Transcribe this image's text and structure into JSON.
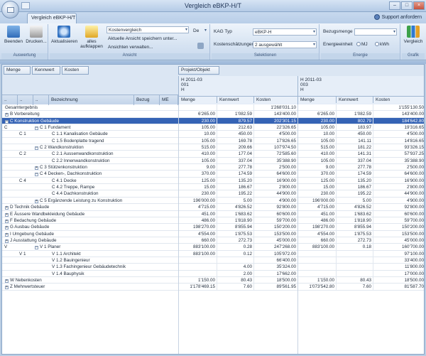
{
  "window": {
    "title": "Vergleich eBKP-H/T",
    "buttons": [
      "–",
      "□",
      "×"
    ]
  },
  "tabs": [
    {
      "label": "Vergleich eBKP-H/T"
    }
  ],
  "support": {
    "label": "Support anfordern"
  },
  "ribbon": {
    "auswertung": {
      "label": "Auswertung",
      "beenden": "Beenden",
      "drucken": "Drucken..."
    },
    "ansicht": {
      "label": "Ansicht",
      "aktualisieren": "Aktualisieren",
      "aufklappen": "alles aufklappen",
      "view_select": "Kostenvergleich",
      "language": "De",
      "save_view": "Aktuelle Ansicht speichern unter...",
      "manage_views": "Ansichten verwalten..."
    },
    "selektionen": {
      "label": "Selektionen",
      "kag_typ_label": "KAG Typ",
      "kag_typ_value": "eBKP-H",
      "kostenschaetzungen_label": "Kostenschätzungen",
      "kostenschaetzungen_value": "2 ausgewählt"
    },
    "energie": {
      "label": "Energie",
      "bezugsmenge_label": "Bezugsmenge",
      "bezugsmenge_value": "",
      "energieeinheit_label": "Energieeinheit",
      "unit_mj": "MJ",
      "unit_kwh": "kWh"
    },
    "grafik": {
      "label": "Grafik",
      "vergleich": "Vergleich"
    }
  },
  "grid": {
    "chips": [
      "Menge",
      "Kennwert",
      "Kosten"
    ],
    "projekt_chip": "Projekt/Objekt",
    "left_headers": [
      "..",
      "..",
      "..",
      "Bezeichnung",
      "Bezug",
      "ME"
    ],
    "projects": [
      {
        "lines": [
          "H 2011-03",
          "001",
          "H"
        ],
        "cols": [
          "Menge",
          "Kennwert",
          "Kosten"
        ]
      },
      {
        "lines": [
          "H 2011-03",
          "003",
          "H"
        ],
        "cols": [
          "Menge",
          "Kennwert",
          "Kosten"
        ]
      }
    ],
    "rows": [
      {
        "l1": "",
        "l2": "",
        "label": "Gesamtergebnis",
        "indent": 0,
        "pm": "",
        "v": [
          "",
          "",
          "1'268'031.10",
          "",
          "",
          "1'155'130.50"
        ]
      },
      {
        "l1": "",
        "l2": "",
        "label": "B Vorbereitung",
        "indent": 0,
        "pm": "+",
        "v": [
          "6'265.00",
          "1'082.59",
          "143'400.00",
          "6'265.00",
          "1'082.59",
          "143'400.00"
        ]
      },
      {
        "l1": "",
        "l2": "",
        "label": "C Konstruktion Gebäude",
        "indent": 0,
        "pm": "–",
        "sel": true,
        "v": [
          "230.00",
          "879.57",
          "202'301.15",
          "230.00",
          "802.79",
          "184'642.80"
        ]
      },
      {
        "l1": "C",
        "l2": "",
        "label": "C 1 Fundament",
        "indent": 1,
        "pm": "–",
        "v": [
          "105.00",
          "212.63",
          "22'326.65",
          "105.00",
          "183.97",
          "19'316.65"
        ]
      },
      {
        "l1": "",
        "l2": "C 1",
        "label": "C 1.1 Kanalisation Gebäude",
        "indent": 2,
        "pm": "",
        "v": [
          "10.00",
          "450.00",
          "4'500.00",
          "10.00",
          "450.00",
          "4'500.00"
        ]
      },
      {
        "l1": "",
        "l2": "",
        "label": "C 1.5 Bodenplatte tragend",
        "indent": 2,
        "pm": "",
        "v": [
          "105.00",
          "169.78",
          "17'826.65",
          "105.00",
          "141.11",
          "14'816.65"
        ]
      },
      {
        "l1": "",
        "l2": "",
        "label": "C 2 Wandkonstruktion",
        "indent": 1,
        "pm": "–",
        "v": [
          "515.00",
          "209.66",
          "107'974.50",
          "515.00",
          "181.22",
          "93'326.15"
        ]
      },
      {
        "l1": "",
        "l2": "C 2",
        "label": "C 2.1 Aussenwandkonstruktion",
        "indent": 2,
        "pm": "",
        "v": [
          "410.00",
          "177.04",
          "72'585.60",
          "410.00",
          "141.31",
          "57'937.25"
        ]
      },
      {
        "l1": "",
        "l2": "",
        "label": "C 2.2 Innenwandkonstruktion",
        "indent": 2,
        "pm": "",
        "v": [
          "105.00",
          "337.04",
          "35'388.90",
          "105.00",
          "337.04",
          "35'388.90"
        ]
      },
      {
        "l1": "",
        "l2": "",
        "label": "C 3 Stützenkonstruktion",
        "indent": 1,
        "pm": "+",
        "v": [
          "9.00",
          "277.78",
          "2'500.00",
          "9.00",
          "277.78",
          "2'500.00"
        ]
      },
      {
        "l1": "",
        "l2": "",
        "label": "C 4 Decken-, Dachkonstruktion",
        "indent": 1,
        "pm": "–",
        "v": [
          "370.00",
          "174.59",
          "64'600.00",
          "370.00",
          "174.59",
          "64'600.00"
        ]
      },
      {
        "l1": "",
        "l2": "C 4",
        "label": "C 4.1 Decke",
        "indent": 2,
        "pm": "",
        "v": [
          "125.00",
          "135.20",
          "16'900.00",
          "125.00",
          "135.20",
          "16'900.00"
        ]
      },
      {
        "l1": "",
        "l2": "",
        "label": "C 4.2 Treppe, Rampe",
        "indent": 2,
        "pm": "",
        "v": [
          "15.00",
          "186.67",
          "2'800.00",
          "15.00",
          "186.67",
          "2'800.00"
        ]
      },
      {
        "l1": "",
        "l2": "",
        "label": "C 4.4 Dachkonstruktion",
        "indent": 2,
        "pm": "",
        "v": [
          "230.00",
          "195.22",
          "44'900.00",
          "230.00",
          "195.22",
          "44'900.00"
        ]
      },
      {
        "l1": "",
        "l2": "",
        "label": "C 5 Ergänzende Leistung zu Konstruktion",
        "indent": 1,
        "pm": "+",
        "v": [
          "196'000.00",
          "5.00",
          "4'900.00",
          "196'000.00",
          "5.00",
          "4'900.00"
        ]
      },
      {
        "l1": "",
        "l2": "",
        "label": "D Technik Gebäude",
        "indent": 0,
        "pm": "+",
        "v": [
          "4'715.00",
          "4'826.52",
          "92'800.00",
          "4'715.00",
          "4'826.52",
          "92'800.00"
        ]
      },
      {
        "l1": "",
        "l2": "",
        "label": "E Äussere Wandbekleidung Gebäude",
        "indent": 0,
        "pm": "+",
        "v": [
          "451.00",
          "1'683.62",
          "60'600.00",
          "451.00",
          "1'683.62",
          "60'600.00"
        ]
      },
      {
        "l1": "",
        "l2": "",
        "label": "F Bedachung Gebäude",
        "indent": 0,
        "pm": "+",
        "v": [
          "486.00",
          "1'818.90",
          "59'700.00",
          "486.00",
          "1'818.90",
          "59'700.00"
        ]
      },
      {
        "l1": "",
        "l2": "",
        "label": "G Ausbau Gebäude",
        "indent": 0,
        "pm": "+",
        "v": [
          "198'270.00",
          "8'855.94",
          "150'200.00",
          "198'270.00",
          "8'855.94",
          "150'200.00"
        ]
      },
      {
        "l1": "",
        "l2": "",
        "label": "I Umgebung Gebäude",
        "indent": 0,
        "pm": "+",
        "v": [
          "4'554.00",
          "1'875.53",
          "153'500.00",
          "4'554.00",
          "1'875.53",
          "153'500.00"
        ]
      },
      {
        "l1": "",
        "l2": "",
        "label": "J Ausstattung Gebäude",
        "indent": 0,
        "pm": "+",
        "v": [
          "660.00",
          "272.73",
          "45'000.00",
          "660.00",
          "272.73",
          "45'000.00"
        ]
      },
      {
        "l1": "V",
        "l2": "",
        "label": "V 1 Planer",
        "indent": 1,
        "pm": "–",
        "v": [
          "883'100.00",
          "0.28",
          "247'268.00",
          "883'100.00",
          "0.18",
          "160'700.00"
        ]
      },
      {
        "l1": "",
        "l2": "V 1",
        "label": "V 1.1 Architekt",
        "indent": 2,
        "pm": "",
        "v": [
          "883'100.00",
          "0.12",
          "105'972.00",
          "",
          "",
          "97'100.00"
        ]
      },
      {
        "l1": "",
        "l2": "",
        "label": "V 1.2 Bauingenieur",
        "indent": 2,
        "pm": "",
        "v": [
          "",
          "",
          "66'400.00",
          "",
          "",
          "33'400.00"
        ]
      },
      {
        "l1": "",
        "l2": "",
        "label": "V 1.3 Fachingenieur Gebäudetechnik",
        "indent": 2,
        "pm": "",
        "v": [
          "",
          "4.00",
          "35'324.00",
          "",
          "",
          "11'800.00"
        ]
      },
      {
        "l1": "",
        "l2": "",
        "label": "V 1.4 Bauphysik",
        "indent": 2,
        "pm": "",
        "v": [
          "",
          "2.00",
          "17'662.00",
          "",
          "",
          "17'000.00"
        ]
      },
      {
        "l1": "",
        "l2": "",
        "label": "W Nebenkosten",
        "indent": 0,
        "pm": "+",
        "v": [
          "1'150.00",
          "80.43",
          "18'500.00",
          "1'150.00",
          "80.43",
          "18'500.00"
        ]
      },
      {
        "l1": "",
        "l2": "",
        "label": "Z Mehrwertsteuer",
        "indent": 0,
        "pm": "+",
        "v": [
          "1'178'469.15",
          "7.60",
          "89'561.95",
          "1'073'542.80",
          "7.60",
          "81'587.70"
        ]
      }
    ]
  }
}
